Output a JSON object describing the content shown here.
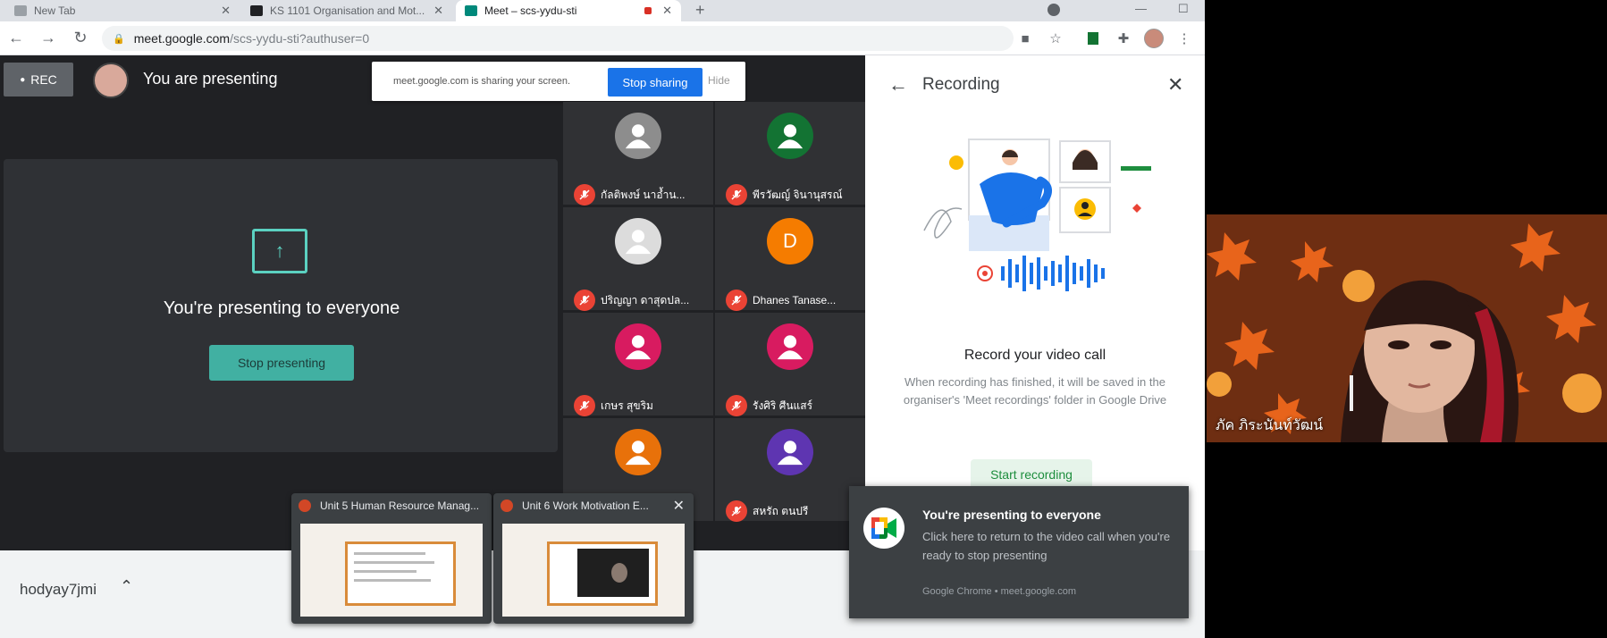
{
  "tabs": [
    {
      "title": "New Tab",
      "favicon_color": "#9aa0a6"
    },
    {
      "title": "KS 1101 Organisation and Mot...",
      "favicon_color": "#202124"
    },
    {
      "title": "Meet – scs-yydu-sti",
      "favicon_color": "#00897b"
    }
  ],
  "toolbar": {
    "url_host": "meet.google.com",
    "url_path": "/scs-yydu-sti?authuser=0"
  },
  "meet": {
    "rec_label": "REC",
    "presenting_label": "You are presenting",
    "share_bar": {
      "message": "meet.google.com is sharing your screen.",
      "stop_label": "Stop sharing",
      "hide_label": "Hide"
    },
    "present_heading": "You're presenting to everyone",
    "stop_presenting_label": "Stop presenting",
    "participants": [
      {
        "name": "กัลติพงษ์ นาอ้ำน...",
        "avatar_type": "photo",
        "avatar_color": "#8d8d8d"
      },
      {
        "name": "พีรวัฒญ์ จินานุสรณ์",
        "avatar_type": "person",
        "avatar_color": "#137333"
      },
      {
        "name": "ปริญญา ดาสุดปล...",
        "avatar_type": "photo",
        "avatar_color": "#dcdcdc"
      },
      {
        "name": "Dhanes Tanase...",
        "avatar_type": "letter",
        "avatar_letter": "D",
        "avatar_color": "#f57c00"
      },
      {
        "name": "เกษร สุขริม",
        "avatar_type": "person",
        "avatar_color": "#d81b60"
      },
      {
        "name": "รังศิริ ศีนแสร์",
        "avatar_type": "person",
        "avatar_color": "#d81b60"
      },
      {
        "name": "",
        "avatar_type": "person",
        "avatar_color": "#e8710a"
      },
      {
        "name": "สหรัถ ตนปรี",
        "avatar_type": "person",
        "avatar_color": "#5e35b1"
      }
    ]
  },
  "panel": {
    "title": "Recording",
    "record_title": "Record your video call",
    "record_description": "When recording has finished, it will be saved in the organiser's 'Meet recordings' folder in Google Drive",
    "start_label": "Start recording"
  },
  "shelf": {
    "item_label": "hodyay7jmi"
  },
  "thumbnails": [
    {
      "title": "Unit 5 Human Resource Manag..."
    },
    {
      "title": "Unit 6 Work Motivation E..."
    }
  ],
  "notification": {
    "title": "You're presenting to everyone",
    "body": "Click here to return to the video call when you're ready to stop presenting",
    "footer": "Google Chrome • meet.google.com"
  },
  "webcam": {
    "label": "ภัค ภิระนันท์วัฒน์"
  }
}
